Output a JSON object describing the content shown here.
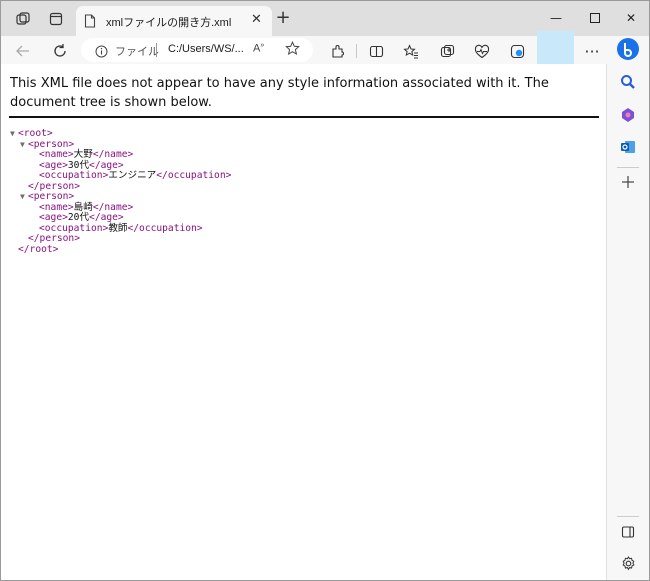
{
  "browser": {
    "tab_title": "xmlファイルの開き方.xml",
    "tab_close": "✕",
    "new_tab": "+",
    "address_label": "ファイル",
    "address_url": "C:/Users/WS/...",
    "read_aloud": "Aͅ",
    "more": "···",
    "minimize": "—",
    "maximize": "☐",
    "close": "✕"
  },
  "page": {
    "notice": "This XML file does not appear to have any style information associated with it. The document tree is shown below."
  },
  "xml": {
    "root_open": "<root>",
    "root_close": "</root>",
    "persons": [
      {
        "open": "<person>",
        "close": "</person>",
        "name_open": "<name>",
        "name": "大野",
        "name_close": "</name>",
        "age_open": "<age>",
        "age": "30代",
        "age_close": "</age>",
        "occ_open": "<occupation>",
        "occupation": "エンジニア",
        "occ_close": "</occupation>"
      },
      {
        "open": "<person>",
        "close": "</person>",
        "name_open": "<name>",
        "name": "島崎",
        "name_close": "</name>",
        "age_open": "<age>",
        "age": "20代",
        "age_close": "</age>",
        "occ_open": "<occupation>",
        "occupation": "教師",
        "occ_close": "</occupation>"
      }
    ]
  },
  "colors": {
    "tag": "#881280",
    "text": "#111111",
    "titlebar": "#dfdfdf",
    "toolbar": "#f7f7f7",
    "profile_highlight": "#c9e9fb"
  }
}
